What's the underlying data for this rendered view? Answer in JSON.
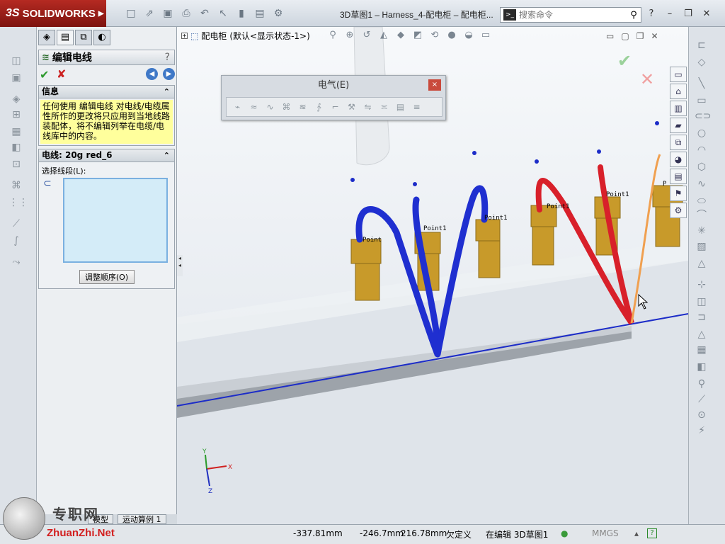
{
  "app": {
    "brand": "SOLIDWORKS",
    "title": "3D草图1 – Harness_4-配电柜 – 配电柜...",
    "search_placeholder": "搜索命令"
  },
  "property_manager": {
    "title": "编辑电线",
    "help": "?",
    "info_group": {
      "heading": "信息",
      "text": "任何使用 编辑电线 对电线/电缆属性所作的更改将只应用到当地线路装配体，将不编辑列举在电缆/电线库中的内容。"
    },
    "wire_group": {
      "heading": "电线: 20g red_6",
      "select_label": "选择线段(L):",
      "reorder_button": "调整顺序(O)"
    }
  },
  "viewport": {
    "tree_label": "配电柜",
    "tree_config": "(默认<显示状态-1>)",
    "triad": {
      "x": "X",
      "y": "Y",
      "z": "Z"
    },
    "point_labels": [
      "Point",
      "Point1",
      "Point1",
      "Point1",
      "Point1",
      "P"
    ]
  },
  "electrical_toolbar": {
    "title": "电气(E)",
    "close": "×"
  },
  "bottom_tabs": [
    "模型",
    "运动算例 1"
  ],
  "status_bar": {
    "x": "-337.81mm",
    "y": "-246.7mm",
    "z": "216.78mm",
    "state": "欠定义",
    "editing": "在编辑 3D草图1",
    "units": "MMGS",
    "help": "?"
  },
  "watermark": {
    "title": "专职网",
    "url": "ZhuanZhi.Net"
  },
  "colors": {
    "wire_blue": "#1f2fd0",
    "wire_red": "#d8202a",
    "wire_orange": "#f0a050",
    "connector": "#c89a2a",
    "brand_red": "#a61e18"
  }
}
